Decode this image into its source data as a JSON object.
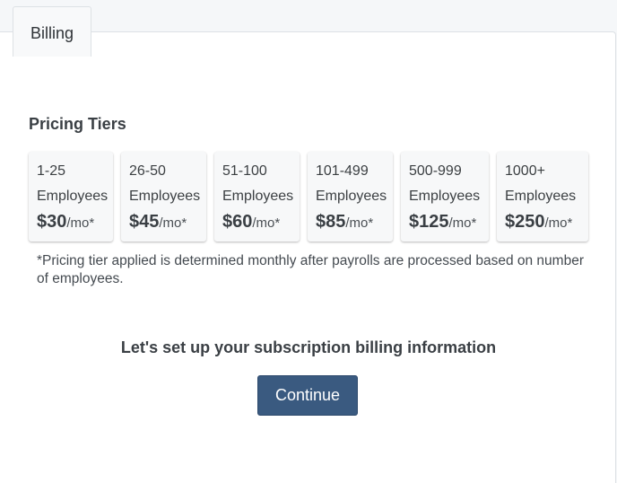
{
  "tab": {
    "label": "Billing"
  },
  "pricing": {
    "title": "Pricing Tiers",
    "tiers": [
      {
        "range": "1-25",
        "unit": "Employees",
        "price": "$30",
        "per": "/mo*"
      },
      {
        "range": "26-50",
        "unit": "Employees",
        "price": "$45",
        "per": "/mo*"
      },
      {
        "range": "51-100",
        "unit": "Employees",
        "price": "$60",
        "per": "/mo*"
      },
      {
        "range": "101-499",
        "unit": "Employees",
        "price": "$85",
        "per": "/mo*"
      },
      {
        "range": "500-999",
        "unit": "Employees",
        "price": "$125",
        "per": "/mo*"
      },
      {
        "range": "1000+",
        "unit": "Employees",
        "price": "$250",
        "per": "/mo*"
      }
    ],
    "note": "*Pricing tier applied is determined monthly after payrolls are processed based on number of employees."
  },
  "setup": {
    "heading": "Let's set up your subscription billing information",
    "continue_label": "Continue"
  },
  "colors": {
    "primary_button": "#3a5a80",
    "panel_background": "#ffffff",
    "page_background": "#f5f7f9"
  }
}
